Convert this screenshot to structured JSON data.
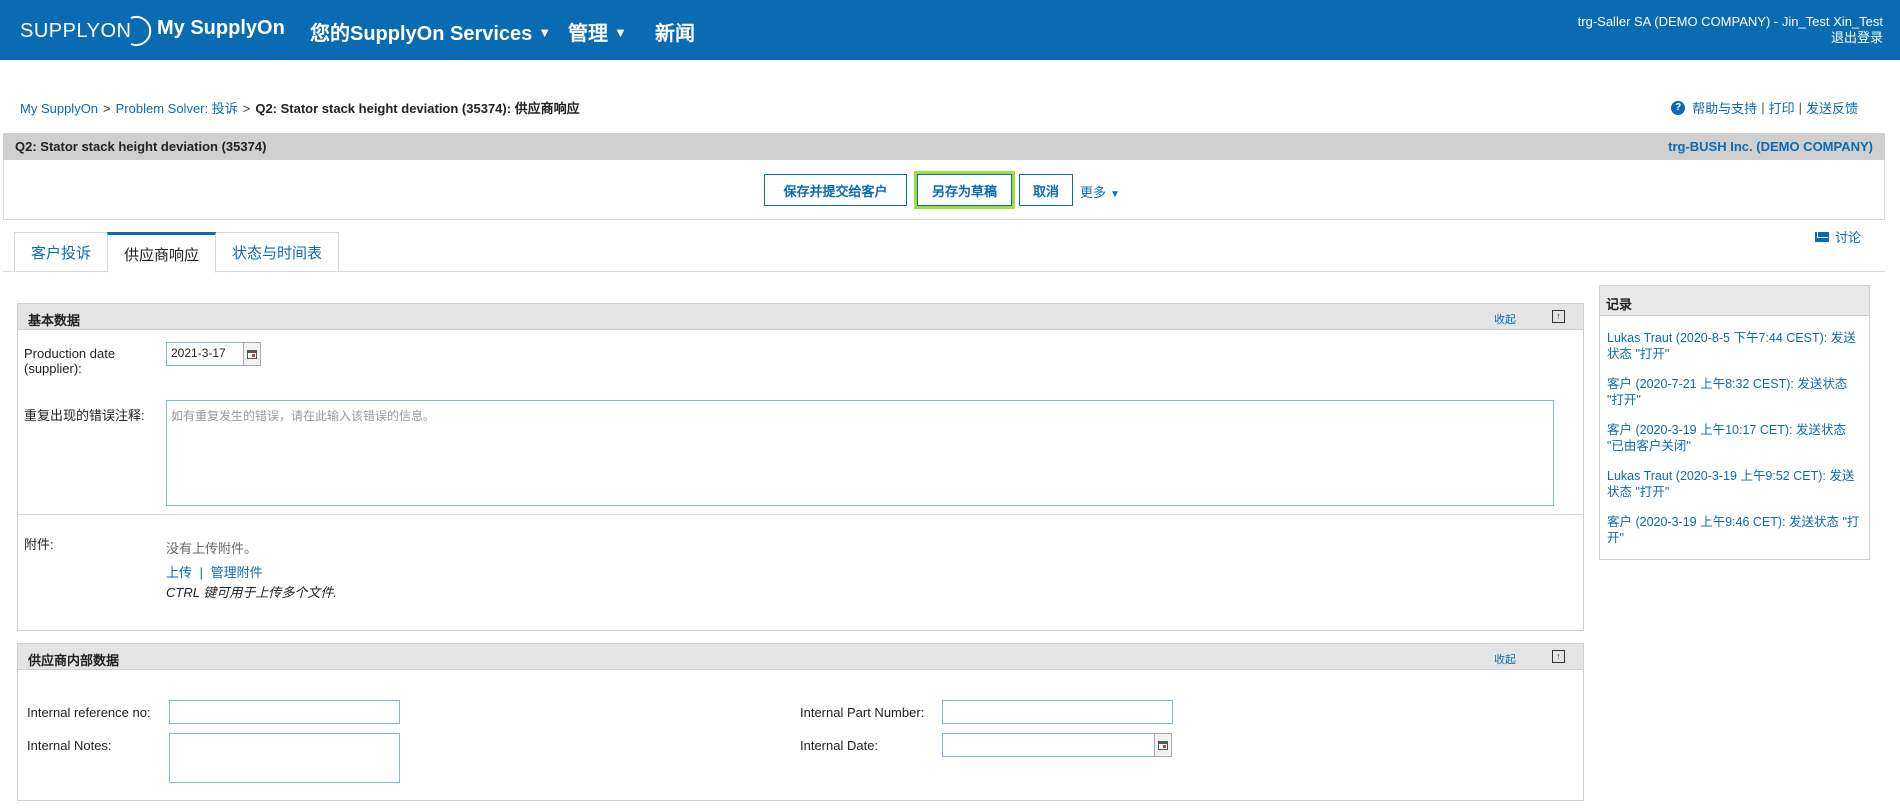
{
  "header": {
    "logo_text": "SUPPLYON",
    "nav": [
      {
        "label": "My SupplyOn",
        "has_caret": false
      },
      {
        "label": "您的SupplyOn Services",
        "has_caret": true
      },
      {
        "label": "管理",
        "has_caret": true
      },
      {
        "label": "新闻",
        "has_caret": false
      }
    ],
    "user": "trg-Saller SA (DEMO COMPANY) - Jin_Test Xin_Test",
    "logout": "退出登录",
    "caret": "▼"
  },
  "breadcrumb": {
    "items": [
      "My SupplyOn",
      "Problem Solver: 投诉"
    ],
    "separator": ">",
    "current": "Q2: Stator stack height deviation (35374): 供应商响应"
  },
  "utilities": {
    "help_icon_glyph": "?",
    "help": "帮助与支持",
    "print": "打印",
    "feedback": "发送反馈",
    "bar": "|"
  },
  "titlebar": {
    "title": "Q2: Stator stack height deviation (35374)",
    "company": "trg-BUSH Inc. (DEMO COMPANY)"
  },
  "actions": {
    "save_submit": "保存并提交给客户",
    "save_draft": "另存为草稿",
    "cancel": "取消",
    "more": "更多"
  },
  "tabs": [
    {
      "label": "客户投诉",
      "active": false
    },
    {
      "label": "供应商响应",
      "active": true
    },
    {
      "label": "状态与时间表",
      "active": false
    }
  ],
  "discuss": "讨论",
  "basic_data": {
    "title": "基本数据",
    "collapse": "收起",
    "pin_glyph": "↑",
    "production_date_label": "Production date (supplier):",
    "production_date_value": "2021-3-17",
    "recurring_label": "重复出现的错误注释:",
    "recurring_placeholder": "如有重复发生的错误，请在此输入该错误的信息。",
    "attachments_label": "附件:",
    "no_attachments": "没有上传附件。",
    "upload": "上传",
    "manage": "管理附件",
    "link_sep": "|",
    "ctrl_hint": "CTRL 键可用于上传多个文件."
  },
  "internal_data": {
    "title": "供应商内部数据",
    "collapse": "收起",
    "pin_glyph": "↑",
    "ref_label": "Internal reference no:",
    "ref_value": "",
    "notes_label": "Internal Notes:",
    "notes_value": "",
    "part_label": "Internal Part Number:",
    "part_value": "",
    "date_label": "Internal Date:",
    "date_value": ""
  },
  "log": {
    "title": "记录",
    "entries": [
      "Lukas Traut (2020-8-5 下午7:44 CEST): 发送状态 \"打开\"",
      "客户 (2020-7-21 上午8:32 CEST): 发送状态 \"打开\"",
      "客户 (2020-3-19 上午10:17 CET): 发送状态 \"已由客户关闭\"",
      "Lukas Traut (2020-3-19 上午9:52 CET): 发送状态 \"打开\"",
      "客户 (2020-3-19 上午9:46 CET): 发送状态 \"打开\""
    ]
  },
  "colors": {
    "brand_blue": "#0a6bb3",
    "highlight_green": "#9ee03a"
  }
}
